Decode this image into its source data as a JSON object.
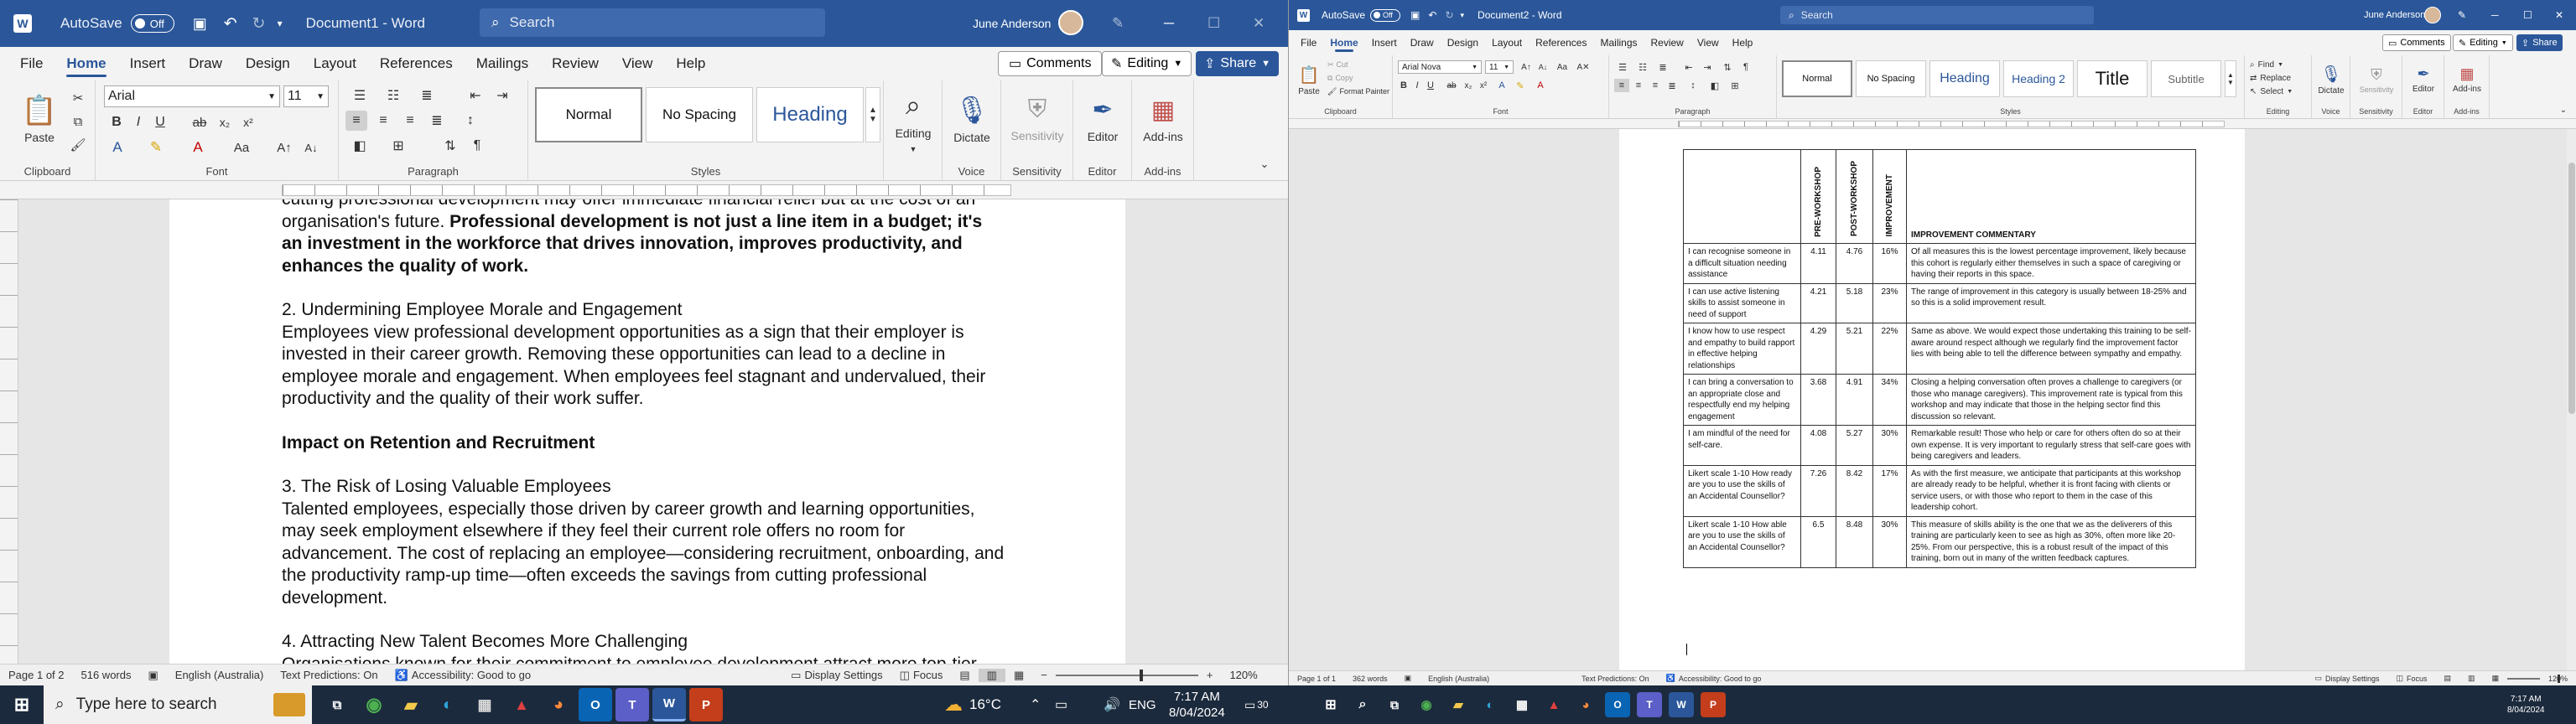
{
  "w1": {
    "autosave": "AutoSave",
    "toggle": "Off",
    "doc": "Document1 - Word",
    "search": "Search",
    "user": "June Anderson",
    "menu": [
      "File",
      "Home",
      "Insert",
      "Draw",
      "Design",
      "Layout",
      "References",
      "Mailings",
      "Review",
      "View",
      "Help"
    ],
    "comments": "Comments",
    "editing": "Editing",
    "share": "Share",
    "font": "Arial",
    "size": "11",
    "styles": [
      "Normal",
      "No Spacing",
      "Heading"
    ],
    "editing_btn": "Editing",
    "dictate": "Dictate",
    "sensitivity": "Sensitivity",
    "editor": "Editor",
    "addins": "Add-ins",
    "groups": [
      "Clipboard",
      "Font",
      "Paragraph",
      "Styles",
      "Voice",
      "Sensitivity",
      "Editor",
      "Add-ins"
    ],
    "paste": "Paste",
    "text": {
      "l0": "cutting professional development may offer immediate financial relief but at the cost of an",
      "l1a": "organisation's future.",
      "l1b": " Professional development is not just a line item in a budget; it's",
      "l2": "an investment in the workforce that drives innovation, improves productivity, and",
      "l3": "enhances the quality of work.",
      "h2": "2. Undermining Employee Morale and Engagement",
      "p2": "Employees view professional development opportunities as a sign that their employer is invested in their career growth. Removing these opportunities can lead to a decline in employee morale and engagement. When employees feel stagnant and undervalued, their productivity and the quality of their work suffer.",
      "h_impact": "Impact on Retention and Recruitment",
      "h3": "3. The Risk of Losing Valuable Employees",
      "p3": "Talented employees, especially those driven by career growth and learning opportunities, may seek employment elsewhere if they feel their current role offers no room for advancement. The cost of replacing an employee—considering recruitment, onboarding, and the productivity ramp-up time—often exceeds the savings from cutting professional development.",
      "h4": "4. Attracting New Talent Becomes More Challenging",
      "p4": "Organisations known for their commitment to employee development attract more top-tier"
    },
    "status": {
      "page": "Page 1 of 2",
      "words": "516 words",
      "lang": "English (Australia)",
      "pred": "Text Predictions: On",
      "access": "Accessibility: Good to go",
      "display": "Display Settings",
      "focus": "Focus",
      "zoom": "120%"
    }
  },
  "w2": {
    "autosave": "AutoSave",
    "toggle": "Off",
    "doc": "Document2 - Word",
    "search": "Search",
    "user": "June Anderson",
    "menu": [
      "File",
      "Home",
      "Insert",
      "Draw",
      "Design",
      "Layout",
      "References",
      "Mailings",
      "Review",
      "View",
      "Help"
    ],
    "comments": "Comments",
    "editing": "Editing",
    "share": "Share",
    "font": "Arial Nova",
    "size": "11",
    "clip": [
      "Cut",
      "Copy",
      "Format Painter"
    ],
    "paste": "Paste",
    "styles": [
      "Normal",
      "No Spacing",
      "Heading",
      "Heading 2",
      "Title",
      "Subtitle"
    ],
    "find": "Find",
    "replace": "Replace",
    "select": "Select",
    "dictate": "Dictate",
    "sensitivity": "Sensitivity",
    "editor": "Editor",
    "addins": "Add-ins",
    "groups": [
      "Clipboard",
      "Font",
      "Paragraph",
      "Styles",
      "Editing",
      "Voice",
      "Sensitivity",
      "Editor",
      "Add-ins"
    ],
    "table": {
      "h1": "PRE-WORKSHOP",
      "h2": "POST-WORKSHOP",
      "h3": "IMPROVEMENT",
      "h4": "IMPROVEMENT COMMENTARY",
      "rows": [
        {
          "item": "I can recognise someone in a difficult situation needing assistance",
          "pre": "4.11",
          "post": "4.76",
          "imp": "16%",
          "c": "Of all measures this is the lowest percentage improvement, likely because this cohort is regularly either themselves in such a space of caregiving or having their reports in this space."
        },
        {
          "item": "I can use active listening skills to assist someone in need of support",
          "pre": "4.21",
          "post": "5.18",
          "imp": "23%",
          "c": "The range of improvement in this category is usually between 18-25% and so this is a solid improvement result."
        },
        {
          "item": "I know how to use respect and empathy to build rapport in effective helping relationships",
          "pre": "4.29",
          "post": "5.21",
          "imp": "22%",
          "c": "Same as above. We would expect those undertaking this training to be self-aware around respect although we regularly find the improvement factor lies with being able to tell the difference between sympathy and empathy."
        },
        {
          "item": "I can bring a conversation to an appropriate close and respectfully end my helping engagement",
          "pre": "3.68",
          "post": "4.91",
          "imp": "34%",
          "c": "Closing a helping conversation often proves a challenge to caregivers (or those who manage caregivers). This improvement rate is typical from this workshop and may indicate that those in the helping sector find this discussion so relevant."
        },
        {
          "item": "I am mindful of the need for self-care.",
          "pre": "4.08",
          "post": "5.27",
          "imp": "30%",
          "c": "Remarkable result! Those who help or care for others often do so at their own expense. It is very important to regularly stress that self-care goes with being caregivers and leaders."
        },
        {
          "item": "Likert scale 1-10 How ready are you to use the skills of an Accidental Counsellor?",
          "pre": "7.26",
          "post": "8.42",
          "imp": "17%",
          "c": "As with the first measure, we anticipate that participants at this workshop are already ready to be helpful, whether it is front facing with clients or service users, or with those who report to them in the case of this leadership cohort."
        },
        {
          "item": "Likert scale 1-10 How able are you to use the skills of an Accidental Counsellor?",
          "pre": "6.5",
          "post": "8.48",
          "imp": "30%",
          "c": "This measure of skills ability is the one that we as the deliverers of this training are particularly keen to see as high as 30%, often more like 20-25%. From our perspective, this is a robust result of the impact of this training, born out in many of the written feedback captures."
        }
      ]
    },
    "status": {
      "page": "Page 1 of 1",
      "words": "362 words",
      "lang": "English (Australia)",
      "pred": "Text Predictions: On",
      "access": "Accessibility: Good to go",
      "display": "Display Settings",
      "focus": "Focus",
      "zoom": "120%"
    }
  },
  "taskbar": {
    "search": "Type here to search",
    "weather": "16°C",
    "lang": "ENG",
    "time": "7:17 AM",
    "date": "8/04/2024",
    "badge": "30"
  }
}
